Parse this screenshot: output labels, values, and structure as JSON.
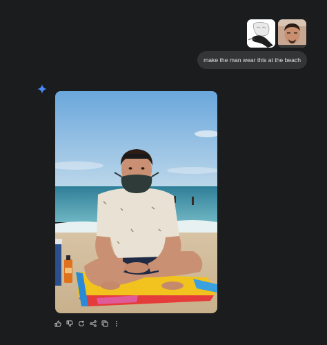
{
  "user_message": {
    "text": "make the man wear this at the beach",
    "attachments": [
      "mask-sketch-thumbnail",
      "man-portrait-thumbnail"
    ]
  },
  "response": {
    "assistant_icon": "sparkle-icon",
    "image": "beach-man-mask-image"
  },
  "actions": [
    {
      "name": "thumbs-up-icon"
    },
    {
      "name": "thumbs-down-icon"
    },
    {
      "name": "regenerate-icon"
    },
    {
      "name": "share-icon"
    },
    {
      "name": "copy-icon"
    },
    {
      "name": "more-icon"
    }
  ],
  "colors": {
    "background": "#1b1c1d",
    "bubble": "#333537",
    "text": "#e3e3e3",
    "accent": "#4a8cf7"
  }
}
